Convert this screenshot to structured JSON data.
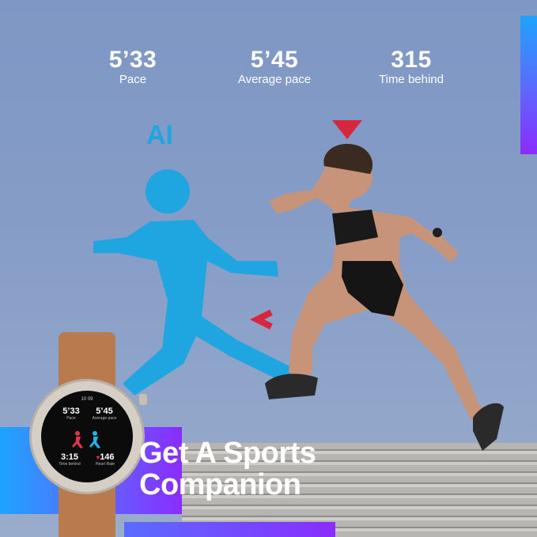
{
  "stats": [
    {
      "value": "5’33",
      "label": "Pace"
    },
    {
      "value": "5’45",
      "label": "Average pace"
    },
    {
      "value": "315",
      "label": "Time behind"
    }
  ],
  "ai_label": "AI",
  "headline": {
    "line1": "Get A Sports",
    "line2": "Companion"
  },
  "watch": {
    "top_status": "10 09",
    "pace_value": "5’33",
    "pace_label": "Pace",
    "avg_value": "5’45",
    "avg_label": "Average pace",
    "time_value": "3:15",
    "time_label": "Time behind",
    "hr_value": "146",
    "hr_label": "Heart Rate"
  },
  "colors": {
    "sky": "#859cc7",
    "accent_blue": "#1ea3ff",
    "accent_purple": "#8a2cff",
    "ai_figure": "#1fa6e0",
    "marker_red": "#d6273c",
    "strap": "#b97a4d"
  }
}
